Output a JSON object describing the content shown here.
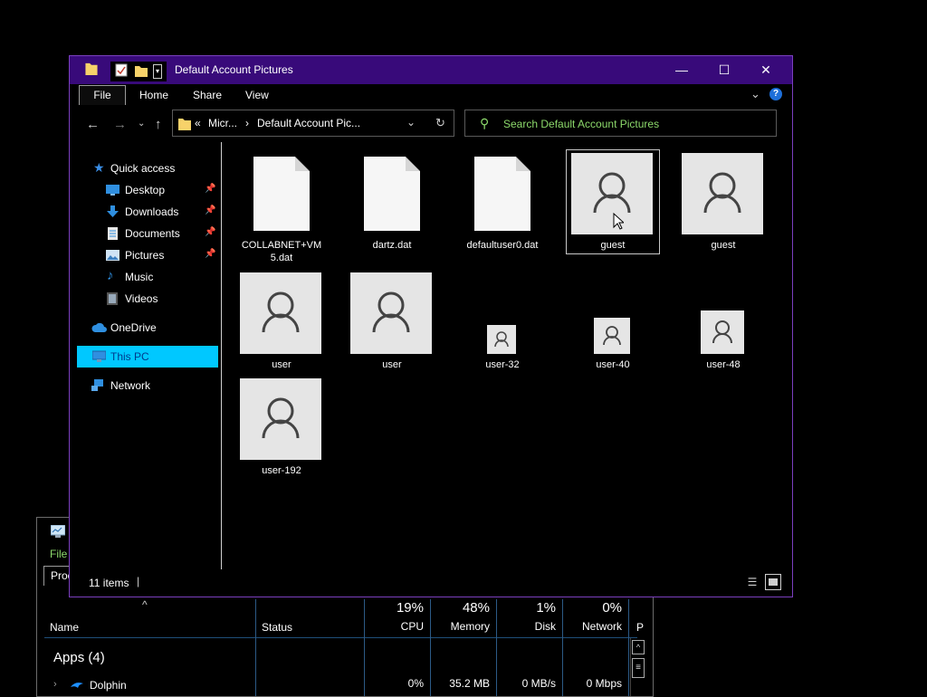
{
  "explorer": {
    "title": "Default Account Pictures",
    "ribbon_tabs": [
      "File",
      "Home",
      "Share",
      "View"
    ],
    "address": {
      "root": "«",
      "part1": "Micr...",
      "sep": "›",
      "part2": "Default Account Pic..."
    },
    "search_placeholder": "Search Default Account Pictures",
    "status_count": "11 items",
    "window_buttons": {
      "min": "—",
      "max": "☐",
      "close": "✕"
    }
  },
  "sidebar": {
    "items": [
      {
        "label": "Quick access",
        "icon": "star-icon"
      },
      {
        "label": "Desktop",
        "icon": "desktop-icon",
        "pinned": true
      },
      {
        "label": "Downloads",
        "icon": "downloads-icon",
        "pinned": true
      },
      {
        "label": "Documents",
        "icon": "documents-icon",
        "pinned": true
      },
      {
        "label": "Pictures",
        "icon": "pictures-icon",
        "pinned": true
      },
      {
        "label": "Music",
        "icon": "music-icon"
      },
      {
        "label": "Videos",
        "icon": "videos-icon"
      },
      {
        "label": "OneDrive",
        "icon": "cloud-icon"
      },
      {
        "label": "This PC",
        "icon": "computer-icon",
        "selected": true
      },
      {
        "label": "Network",
        "icon": "network-icon"
      }
    ]
  },
  "files": [
    {
      "name": "COLLABNET+VM\n5.dat",
      "line1": "COLLABNET+VM",
      "line2": "5.dat",
      "type": "doc"
    },
    {
      "name": "dartz.dat",
      "type": "doc"
    },
    {
      "name": "defaultuser0.dat",
      "type": "doc"
    },
    {
      "name": "guest",
      "type": "avatar",
      "selected": true
    },
    {
      "name": "guest",
      "type": "avatar"
    },
    {
      "name": "user",
      "type": "avatar"
    },
    {
      "name": "user",
      "type": "avatar"
    },
    {
      "name": "user-32",
      "type": "avatar-small"
    },
    {
      "name": "user-40",
      "type": "avatar-small"
    },
    {
      "name": "user-48",
      "type": "avatar-small"
    },
    {
      "name": "user-192",
      "type": "avatar"
    }
  ],
  "taskmanager": {
    "file_menu": "File",
    "tab_label": "Proc",
    "columns": {
      "name": "Name",
      "status": "Status",
      "cpu": {
        "pct": "19%",
        "label": "CPU",
        "value": "0%"
      },
      "memory": {
        "pct": "48%",
        "label": "Memory",
        "value": "35.2 MB"
      },
      "disk": {
        "pct": "1%",
        "label": "Disk",
        "value": "0 MB/s"
      },
      "network": {
        "pct": "0%",
        "label": "Network",
        "value": "0 Mbps"
      },
      "power": "P"
    },
    "group": "Apps (4)",
    "row_name": "Dolphin"
  },
  "colors": {
    "titlebar": "#380a7a",
    "accent_green": "#8cd96b",
    "selection": "#00c8ff"
  }
}
